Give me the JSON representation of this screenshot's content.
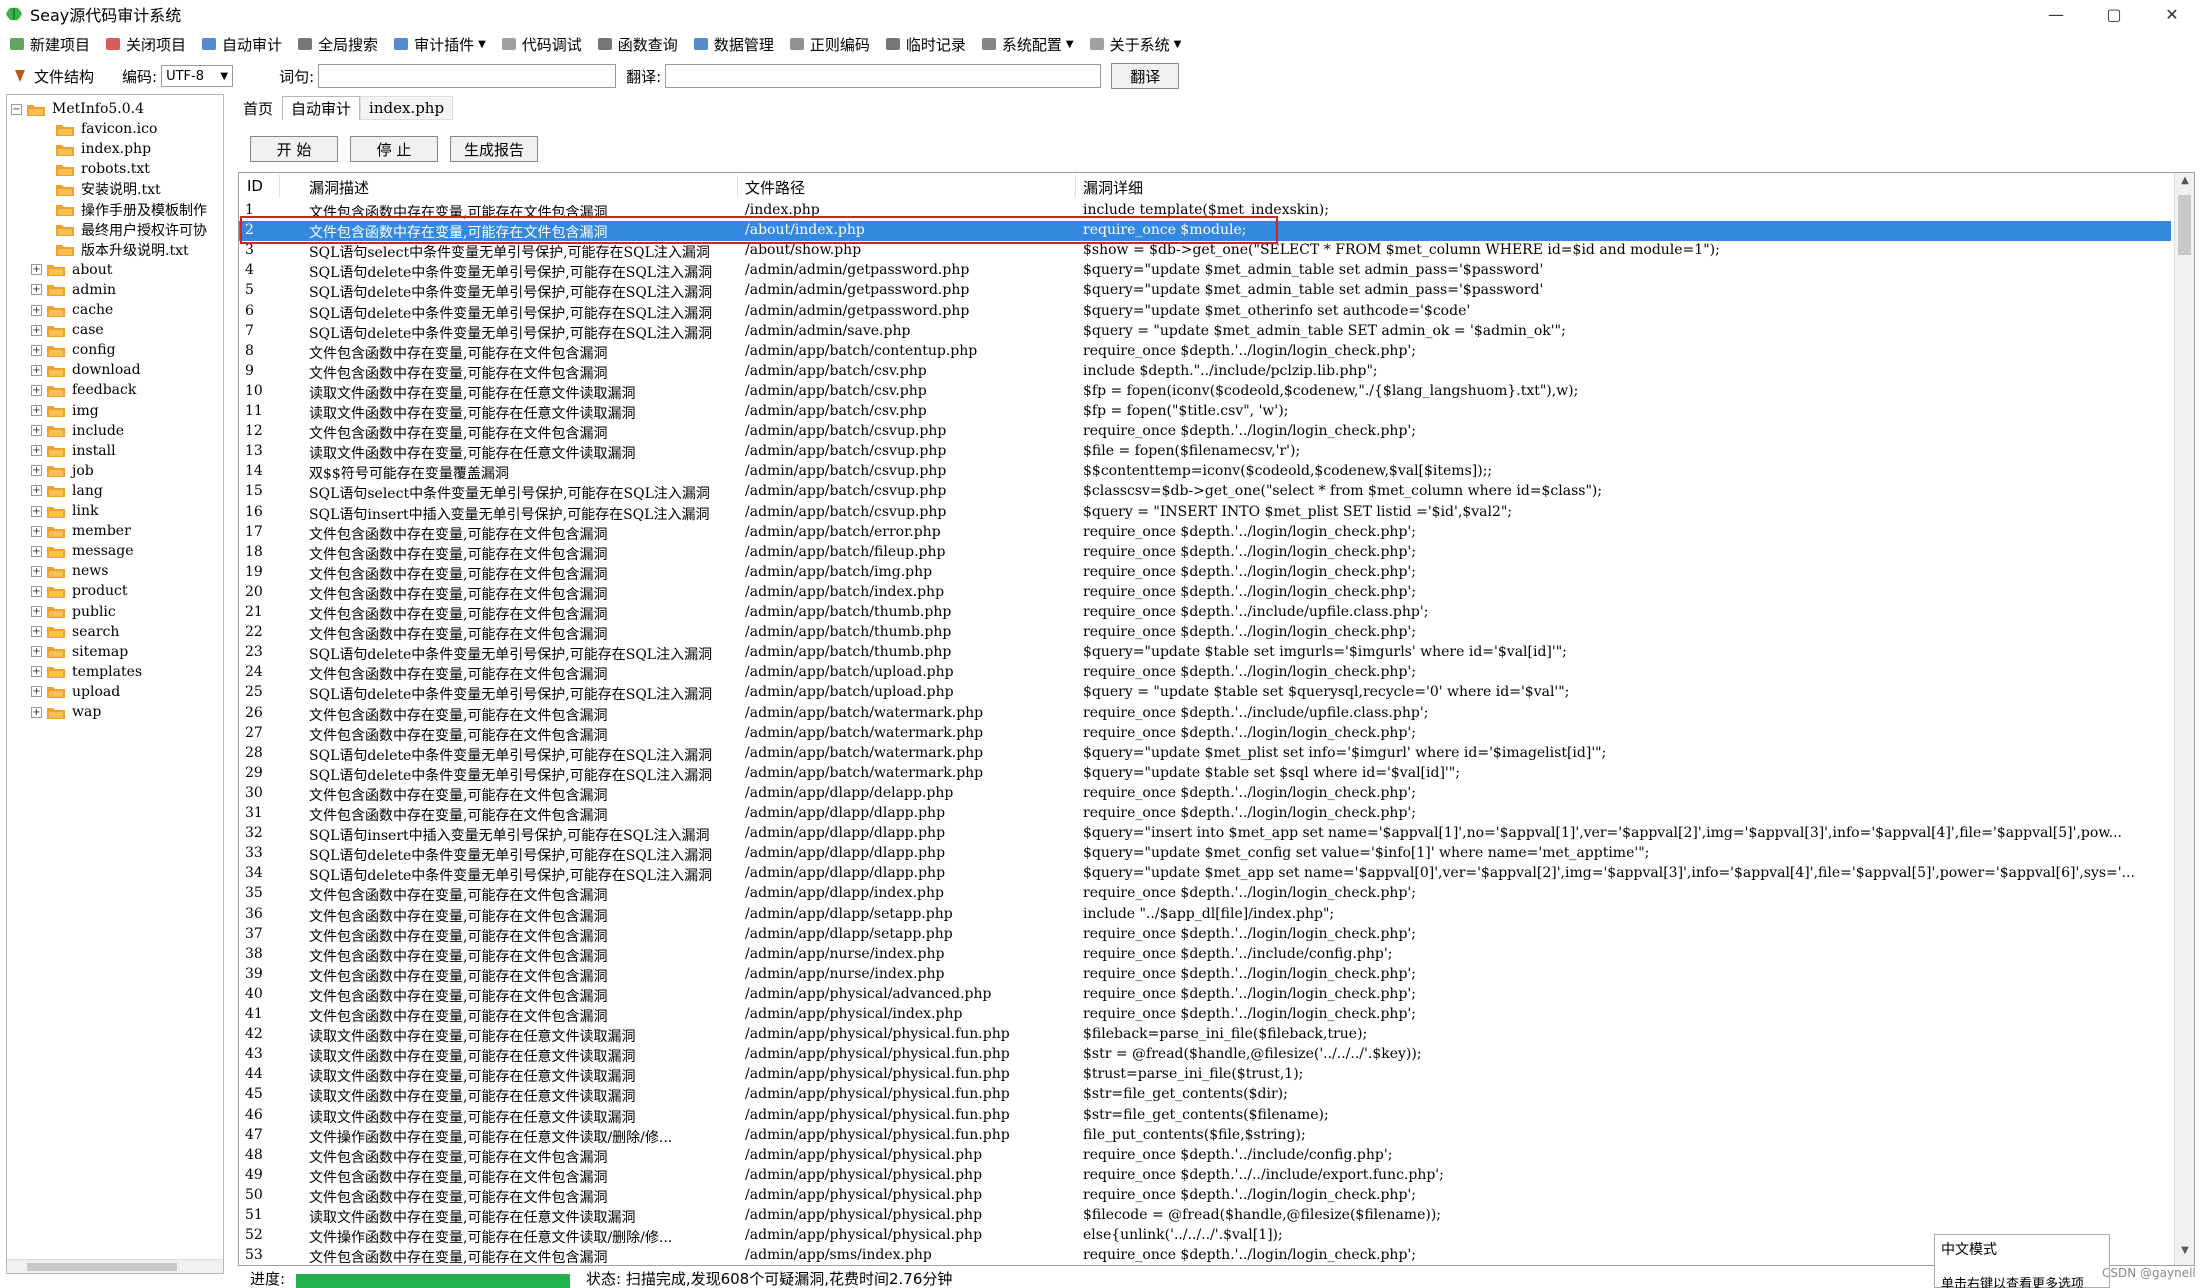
{
  "window": {
    "title": "Seay源代码审计系统",
    "minimize": "—",
    "maximize": "▢",
    "close": "✕"
  },
  "menu": [
    {
      "label": "新建项目",
      "icon": "new-project-icon"
    },
    {
      "label": "关闭项目",
      "icon": "close-project-icon"
    },
    {
      "label": "自动审计",
      "icon": "auto-audit-icon"
    },
    {
      "label": "全局搜索",
      "icon": "search-icon"
    },
    {
      "label": "审计插件",
      "icon": "plugin-icon",
      "dropdown": true
    },
    {
      "label": "代码调试",
      "icon": "debug-icon"
    },
    {
      "label": "函数查询",
      "icon": "function-search-icon"
    },
    {
      "label": "数据管理",
      "icon": "database-icon"
    },
    {
      "label": "正则编码",
      "icon": "regex-icon"
    },
    {
      "label": "临时记录",
      "icon": "note-icon"
    },
    {
      "label": "系统配置",
      "icon": "gear-icon",
      "dropdown": true
    },
    {
      "label": "关于系统",
      "icon": "info-icon",
      "dropdown": true
    }
  ],
  "toolbar2": {
    "file_structure": "文件结构",
    "encoding_label": "编码:",
    "encoding_value": "UTF-8",
    "word_label": "词句:",
    "word_value": "",
    "translate_label": "翻译:",
    "translate_value": "",
    "translate_button": "翻译"
  },
  "tree": {
    "root": "MetInfo5.0.4",
    "files": [
      "favicon.ico",
      "index.php",
      "robots.txt",
      "安装说明.txt",
      "操作手册及模板制作",
      "最终用户授权许可协",
      "版本升级说明.txt"
    ],
    "folders": [
      "about",
      "admin",
      "cache",
      "case",
      "config",
      "download",
      "feedback",
      "img",
      "include",
      "install",
      "job",
      "lang",
      "link",
      "member",
      "message",
      "news",
      "product",
      "public",
      "search",
      "sitemap",
      "templates",
      "upload",
      "wap"
    ]
  },
  "tabs": [
    "首页",
    "自动审计",
    "index.php"
  ],
  "actions": {
    "start": "开 始",
    "stop": "停 止",
    "report": "生成报告"
  },
  "grid": {
    "headers": {
      "id": "ID",
      "desc": "漏洞描述",
      "path": "文件路径",
      "detail": "漏洞详细"
    },
    "selected_id": 2,
    "rows": [
      [
        "1",
        "文件包含函数中存在变量,可能存在文件包含漏洞",
        "/index.php",
        "include template($met_indexskin);"
      ],
      [
        "2",
        "文件包含函数中存在变量,可能存在文件包含漏洞",
        "/about/index.php",
        "require_once $module;"
      ],
      [
        "3",
        "SQL语句select中条件变量无单引号保护,可能存在SQL注入漏洞",
        "/about/show.php",
        "$show = $db->get_one(\"SELECT * FROM $met_column WHERE id=$id and module=1\");"
      ],
      [
        "4",
        "SQL语句delete中条件变量无单引号保护,可能存在SQL注入漏洞",
        "/admin/admin/getpassword.php",
        "$query=\"update $met_admin_table set  admin_pass='$password'"
      ],
      [
        "5",
        "SQL语句delete中条件变量无单引号保护,可能存在SQL注入漏洞",
        "/admin/admin/getpassword.php",
        "$query=\"update $met_admin_table set  admin_pass='$password'"
      ],
      [
        "6",
        "SQL语句delete中条件变量无单引号保护,可能存在SQL注入漏洞",
        "/admin/admin/getpassword.php",
        "$query=\"update $met_otherinfo set  authcode='$code'"
      ],
      [
        "7",
        "SQL语句delete中条件变量无单引号保护,可能存在SQL注入漏洞",
        "/admin/admin/save.php",
        "$query = \"update $met_admin_table SET admin_ok = '$admin_ok'\";"
      ],
      [
        "8",
        "文件包含函数中存在变量,可能存在文件包含漏洞",
        "/admin/app/batch/contentup.php",
        "require_once $depth.'../login/login_check.php';"
      ],
      [
        "9",
        "文件包含函数中存在变量,可能存在文件包含漏洞",
        "/admin/app/batch/csv.php",
        "include $depth.\"../include/pclzip.lib.php\";"
      ],
      [
        "10",
        "读取文件函数中存在变量,可能存在任意文件读取漏洞",
        "/admin/app/batch/csv.php",
        "$fp = fopen(iconv($codeold,$codenew,\"./{$lang_langshuom}.txt\"),w);"
      ],
      [
        "11",
        "读取文件函数中存在变量,可能存在任意文件读取漏洞",
        "/admin/app/batch/csv.php",
        "$fp = fopen(\"$title.csv\", 'w');"
      ],
      [
        "12",
        "文件包含函数中存在变量,可能存在文件包含漏洞",
        "/admin/app/batch/csvup.php",
        "require_once $depth.'../login/login_check.php';"
      ],
      [
        "13",
        "读取文件函数中存在变量,可能存在任意文件读取漏洞",
        "/admin/app/batch/csvup.php",
        "$file = fopen($filenamecsv,'r');"
      ],
      [
        "14",
        "双$$符号可能存在变量覆盖漏洞",
        "/admin/app/batch/csvup.php",
        "$$contenttemp=iconv($codeold,$codenew,$val[$items]);;"
      ],
      [
        "15",
        "SQL语句select中条件变量无单引号保护,可能存在SQL注入漏洞",
        "/admin/app/batch/csvup.php",
        "$classcsv=$db->get_one(\"select * from $met_column where id=$class\");"
      ],
      [
        "16",
        "SQL语句insert中插入变量无单引号保护,可能存在SQL注入漏洞",
        "/admin/app/batch/csvup.php",
        "$query = \"INSERT INTO $met_plist SET listid ='$id',$val2\";"
      ],
      [
        "17",
        "文件包含函数中存在变量,可能存在文件包含漏洞",
        "/admin/app/batch/error.php",
        "require_once $depth.'../login/login_check.php';"
      ],
      [
        "18",
        "文件包含函数中存在变量,可能存在文件包含漏洞",
        "/admin/app/batch/fileup.php",
        "require_once $depth.'../login/login_check.php';"
      ],
      [
        "19",
        "文件包含函数中存在变量,可能存在文件包含漏洞",
        "/admin/app/batch/img.php",
        "require_once $depth.'../login/login_check.php';"
      ],
      [
        "20",
        "文件包含函数中存在变量,可能存在文件包含漏洞",
        "/admin/app/batch/index.php",
        "require_once $depth.'../login/login_check.php';"
      ],
      [
        "21",
        "文件包含函数中存在变量,可能存在文件包含漏洞",
        "/admin/app/batch/thumb.php",
        "require_once $depth.'../include/upfile.class.php';"
      ],
      [
        "22",
        "文件包含函数中存在变量,可能存在文件包含漏洞",
        "/admin/app/batch/thumb.php",
        "require_once $depth.'../login/login_check.php';"
      ],
      [
        "23",
        "SQL语句delete中条件变量无单引号保护,可能存在SQL注入漏洞",
        "/admin/app/batch/thumb.php",
        "$query=\"update $table set imgurls='$imgurls' where id='$val[id]'\";"
      ],
      [
        "24",
        "文件包含函数中存在变量,可能存在文件包含漏洞",
        "/admin/app/batch/upload.php",
        "require_once $depth.'../login/login_check.php';"
      ],
      [
        "25",
        "SQL语句delete中条件变量无单引号保护,可能存在SQL注入漏洞",
        "/admin/app/batch/upload.php",
        "$query = \"update $table set $querysql,recycle='0' where id='$val'\";"
      ],
      [
        "26",
        "文件包含函数中存在变量,可能存在文件包含漏洞",
        "/admin/app/batch/watermark.php",
        "require_once $depth.'../include/upfile.class.php';"
      ],
      [
        "27",
        "文件包含函数中存在变量,可能存在文件包含漏洞",
        "/admin/app/batch/watermark.php",
        "require_once $depth.'../login/login_check.php';"
      ],
      [
        "28",
        "SQL语句delete中条件变量无单引号保护,可能存在SQL注入漏洞",
        "/admin/app/batch/watermark.php",
        "$query=\"update $met_plist set info='$imgurl' where id='$imagelist[id]'\";"
      ],
      [
        "29",
        "SQL语句delete中条件变量无单引号保护,可能存在SQL注入漏洞",
        "/admin/app/batch/watermark.php",
        "$query=\"update $table set $sql where id='$val[id]'\";"
      ],
      [
        "30",
        "文件包含函数中存在变量,可能存在文件包含漏洞",
        "/admin/app/dlapp/delapp.php",
        "require_once $depth.'../login/login_check.php';"
      ],
      [
        "31",
        "文件包含函数中存在变量,可能存在文件包含漏洞",
        "/admin/app/dlapp/dlapp.php",
        "require_once $depth.'../login/login_check.php';"
      ],
      [
        "32",
        "SQL语句insert中插入变量无单引号保护,可能存在SQL注入漏洞",
        "/admin/app/dlapp/dlapp.php",
        "$query=\"insert into $met_app set name='$appval[1]',no='$appval[1]',ver='$appval[2]',img='$appval[3]',info='$appval[4]',file='$appval[5]',pow..."
      ],
      [
        "33",
        "SQL语句delete中条件变量无单引号保护,可能存在SQL注入漏洞",
        "/admin/app/dlapp/dlapp.php",
        "$query=\"update $met_config set value='$info[1]' where name='met_apptime'\";"
      ],
      [
        "34",
        "SQL语句delete中条件变量无单引号保护,可能存在SQL注入漏洞",
        "/admin/app/dlapp/dlapp.php",
        "$query=\"update $met_app set name='$appval[0]',ver='$appval[2]',img='$appval[3]',info='$appval[4]',file='$appval[5]',power='$appval[6]',sys='..."
      ],
      [
        "35",
        "文件包含函数中存在变量,可能存在文件包含漏洞",
        "/admin/app/dlapp/index.php",
        "require_once $depth.'../login/login_check.php';"
      ],
      [
        "36",
        "文件包含函数中存在变量,可能存在文件包含漏洞",
        "/admin/app/dlapp/setapp.php",
        "include \"../$app_dl[file]/index.php\";"
      ],
      [
        "37",
        "文件包含函数中存在变量,可能存在文件包含漏洞",
        "/admin/app/dlapp/setapp.php",
        "require_once $depth.'../login/login_check.php';"
      ],
      [
        "38",
        "文件包含函数中存在变量,可能存在文件包含漏洞",
        "/admin/app/nurse/index.php",
        "require_once $depth.'../include/config.php';"
      ],
      [
        "39",
        "文件包含函数中存在变量,可能存在文件包含漏洞",
        "/admin/app/nurse/index.php",
        "require_once $depth.'../login/login_check.php';"
      ],
      [
        "40",
        "文件包含函数中存在变量,可能存在文件包含漏洞",
        "/admin/app/physical/advanced.php",
        "require_once $depth.'../login/login_check.php';"
      ],
      [
        "41",
        "文件包含函数中存在变量,可能存在文件包含漏洞",
        "/admin/app/physical/index.php",
        "require_once $depth.'../login/login_check.php';"
      ],
      [
        "42",
        "读取文件函数中存在变量,可能存在任意文件读取漏洞",
        "/admin/app/physical/physical.fun.php",
        "$fileback=parse_ini_file($fileback,true);"
      ],
      [
        "43",
        "读取文件函数中存在变量,可能存在任意文件读取漏洞",
        "/admin/app/physical/physical.fun.php",
        "$str = @fread($handle,@filesize('../../../'.$key));"
      ],
      [
        "44",
        "读取文件函数中存在变量,可能存在任意文件读取漏洞",
        "/admin/app/physical/physical.fun.php",
        "$trust=parse_ini_file($trust,1);"
      ],
      [
        "45",
        "读取文件函数中存在变量,可能存在任意文件读取漏洞",
        "/admin/app/physical/physical.fun.php",
        "$str=file_get_contents($dir);"
      ],
      [
        "46",
        "读取文件函数中存在变量,可能存在任意文件读取漏洞",
        "/admin/app/physical/physical.fun.php",
        "$str=file_get_contents($filename);"
      ],
      [
        "47",
        "文件操作函数中存在变量,可能存在任意文件读取/删除/修...",
        "/admin/app/physical/physical.fun.php",
        "file_put_contents($file,$string);"
      ],
      [
        "48",
        "文件包含函数中存在变量,可能存在文件包含漏洞",
        "/admin/app/physical/physical.php",
        "require_once $depth.'../include/config.php';"
      ],
      [
        "49",
        "文件包含函数中存在变量,可能存在文件包含漏洞",
        "/admin/app/physical/physical.php",
        "require_once $depth.'../../include/export.func.php';"
      ],
      [
        "50",
        "文件包含函数中存在变量,可能存在文件包含漏洞",
        "/admin/app/physical/physical.php",
        "require_once $depth.'../login/login_check.php';"
      ],
      [
        "51",
        "读取文件函数中存在变量,可能存在任意文件读取漏洞",
        "/admin/app/physical/physical.php",
        "$filecode = @fread($handle,@filesize($filename));"
      ],
      [
        "52",
        "文件操作函数中存在变量,可能存在任意文件读取/删除/修...",
        "/admin/app/physical/physical.php",
        "else{unlink('../../../'.$val[1]);"
      ],
      [
        "53",
        "文件包含函数中存在变量,可能存在文件包含漏洞",
        "/admin/app/sms/index.php",
        "require_once $depth.'../login/login_check.php';"
      ]
    ]
  },
  "status": {
    "progress_label": "进度:",
    "progress_fraction": 1.0,
    "text": "状态: 扫描完成,发现608个可疑漏洞,花费时间2.76分钟"
  },
  "ime": {
    "mode": "中文模式",
    "hint": "单击右键以查看更多选项"
  },
  "watermark": "CSDN @gaynell",
  "colors": {
    "selection": "#3388e0",
    "progress": "#22b14c",
    "highlight_box": "#d81e2c",
    "folder": "#f0a030"
  }
}
